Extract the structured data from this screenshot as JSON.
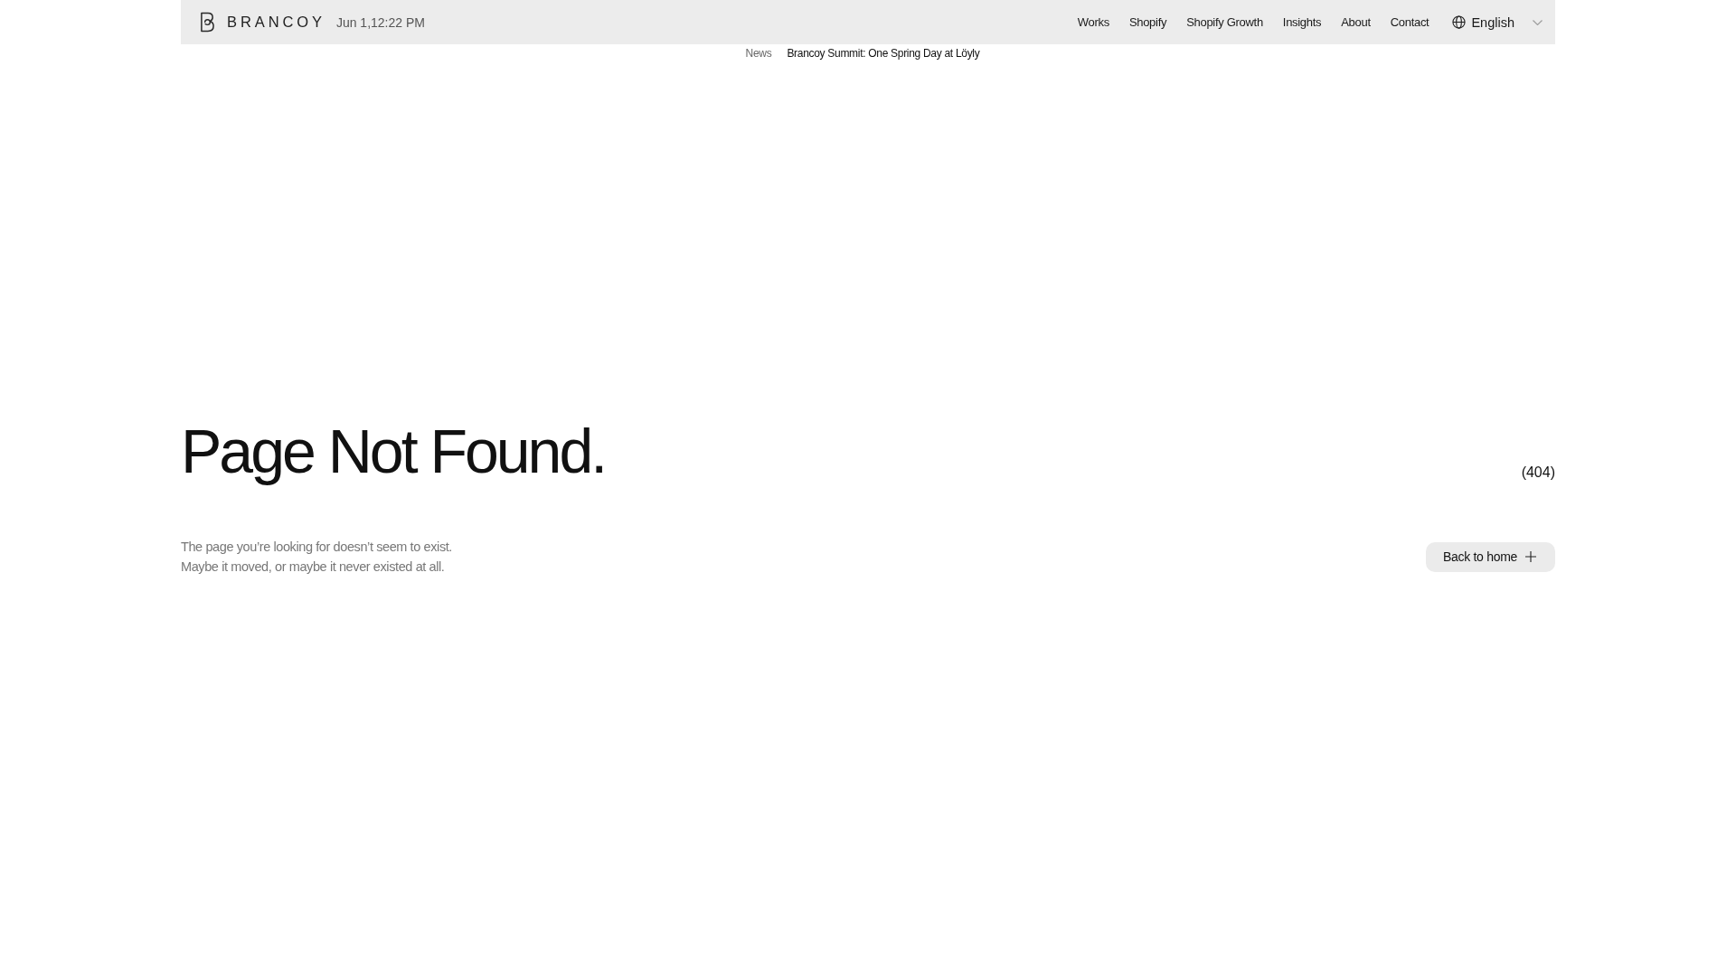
{
  "header": {
    "brand": "BRANCOY",
    "datetime": "Jun 1,12:22 PM",
    "nav": [
      "Works",
      "Shopify",
      "Shopify Growth",
      "Insights",
      "About",
      "Contact"
    ],
    "language": "English"
  },
  "news": {
    "label": "News",
    "headline": "Brancoy Summit: One Spring Day at Löyly"
  },
  "hero": {
    "title": "Page Not Found.",
    "code": "(404)"
  },
  "message": {
    "lines": [
      "The page you’re looking for doesn’t seem to exist.",
      "Maybe it moved, or maybe it never existed at all."
    ]
  },
  "button": {
    "label": "Back to home"
  }
}
